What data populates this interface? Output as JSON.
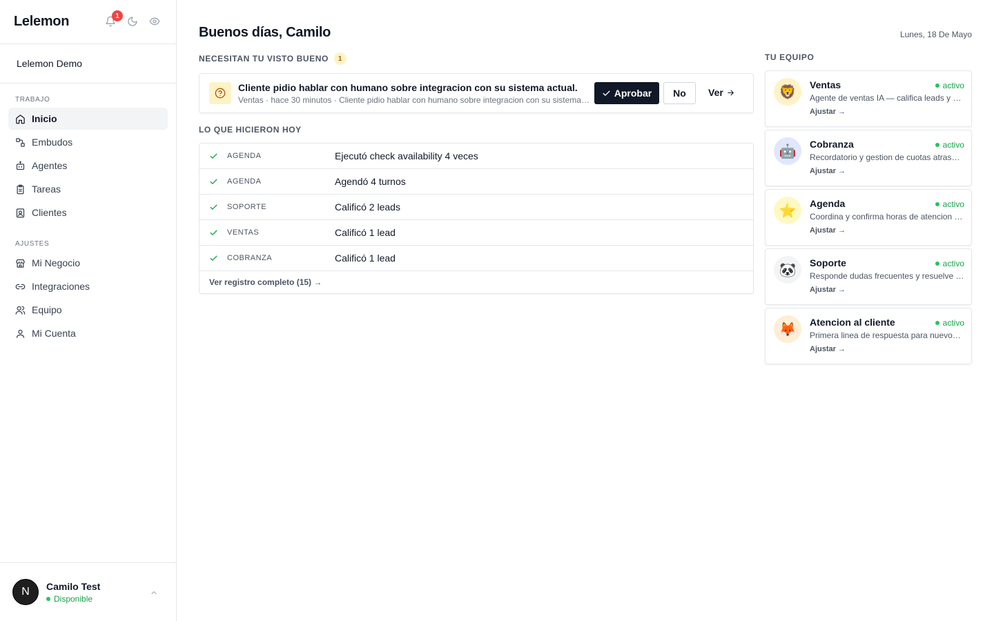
{
  "app": {
    "brand": "Lelemon",
    "notification_count": "1",
    "workspace": "Lelemon Demo"
  },
  "sidebar": {
    "sections": [
      {
        "label": "TRABAJO",
        "items": [
          {
            "label": "Inicio",
            "icon": "home-icon",
            "active": true
          },
          {
            "label": "Embudos",
            "icon": "funnel-icon"
          },
          {
            "label": "Agentes",
            "icon": "bot-icon"
          },
          {
            "label": "Tareas",
            "icon": "clipboard-icon"
          },
          {
            "label": "Clientes",
            "icon": "contacts-icon"
          }
        ]
      },
      {
        "label": "AJUSTES",
        "items": [
          {
            "label": "Mi Negocio",
            "icon": "store-icon"
          },
          {
            "label": "Integraciones",
            "icon": "link-icon"
          },
          {
            "label": "Equipo",
            "icon": "users-icon"
          },
          {
            "label": "Mi Cuenta",
            "icon": "user-icon"
          }
        ]
      }
    ]
  },
  "user": {
    "initial": "N",
    "name": "Camilo Test",
    "status": "Disponible"
  },
  "header": {
    "greeting": "Buenos días, Camilo",
    "date": "Lunes, 18 De Mayo"
  },
  "approvals": {
    "title": "NECESITAN TU VISTO BUENO",
    "count": "1",
    "items": [
      {
        "title": "Cliente pidio hablar con humano sobre integracion con su sistema actual.",
        "meta": "Ventas · hace 30 minutos · Cliente pidio hablar con humano sobre integracion con su sistema actual.",
        "approve_label": "Aprobar",
        "reject_label": "No",
        "view_label": "Ver"
      }
    ]
  },
  "activity": {
    "title": "LO QUE HICIERON HOY",
    "rows": [
      {
        "category": "AGENDA",
        "text": "Ejecutó check availability 4 veces"
      },
      {
        "category": "AGENDA",
        "text": "Agendó 4 turnos"
      },
      {
        "category": "SOPORTE",
        "text": "Calificó 2 leads"
      },
      {
        "category": "VENTAS",
        "text": "Calificó 1 lead"
      },
      {
        "category": "COBRANZA",
        "text": "Calificó 1 lead"
      }
    ],
    "footer": "Ver registro completo (15) →"
  },
  "team": {
    "title": "TU EQUIPO",
    "agents": [
      {
        "name": "Ventas",
        "status": "activo",
        "desc": "Agente de ventas IA — califica leads y agenda demos",
        "link": "Ajustar →",
        "emoji": "🦁",
        "bg": "#fef3c7"
      },
      {
        "name": "Cobranza",
        "status": "activo",
        "desc": "Recordatorio y gestion de cuotas atrasadas",
        "link": "Ajustar →",
        "emoji": "🤖",
        "bg": "#e0e7ff"
      },
      {
        "name": "Agenda",
        "status": "activo",
        "desc": "Coordina y confirma horas de atencion con clientes",
        "link": "Ajustar →",
        "emoji": "⭐",
        "bg": "#fef9c3"
      },
      {
        "name": "Soporte",
        "status": "activo",
        "desc": "Responde dudas frecuentes y resuelve incidencias",
        "link": "Ajustar →",
        "emoji": "🐼",
        "bg": "#f3f4f6"
      },
      {
        "name": "Atencion al cliente",
        "status": "activo",
        "desc": "Primera linea de respuesta para nuevos clientes",
        "link": "Ajustar →",
        "emoji": "🦊",
        "bg": "#ffedd5"
      }
    ]
  }
}
